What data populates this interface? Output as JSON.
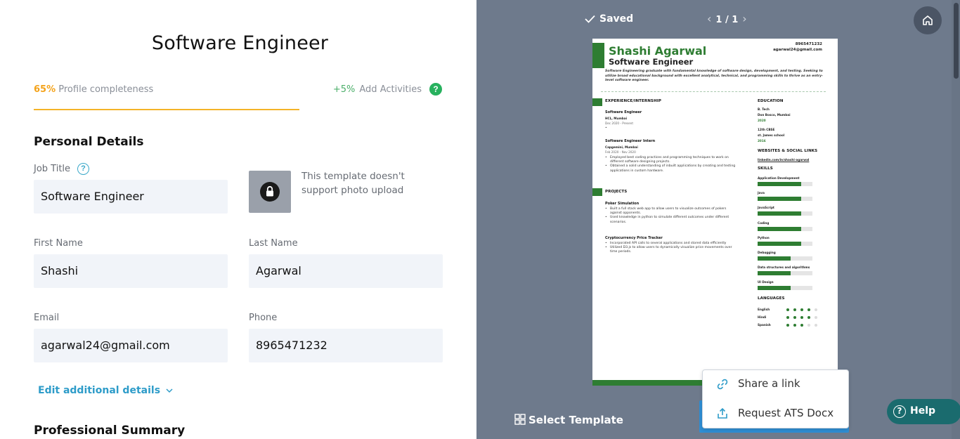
{
  "editor": {
    "title": "Software Engineer",
    "completeness_pct": "65%",
    "completeness_label": "Profile completeness",
    "add_pct": "+5%",
    "add_label": "Add Activities",
    "help_mark": "?"
  },
  "personal": {
    "heading": "Personal Details",
    "job_title_label": "Job Title",
    "job_title_value": "Software Engineer",
    "info_mark": "?",
    "photo_note": "This template doesn't support photo upload",
    "first_name_label": "First Name",
    "first_name_value": "Shashi",
    "last_name_label": "Last Name",
    "last_name_value": "Agarwal",
    "email_label": "Email",
    "email_value": "agarwal24@gmail.com",
    "phone_label": "Phone",
    "phone_value": "8965471232",
    "edit_link": "Edit additional details"
  },
  "summary_section": {
    "heading": "Professional Summary"
  },
  "preview": {
    "saved": "Saved",
    "page_indicator": "1 / 1",
    "prev_chevron": "‹",
    "next_chevron": "›",
    "select_template": "Select Template",
    "share_menu": [
      {
        "label": "Share a link",
        "icon": "link-icon"
      },
      {
        "label": "Request ATS Docx",
        "icon": "upload-icon"
      }
    ],
    "help_label": "Help",
    "help_mark": "?"
  },
  "resume": {
    "name": "Shashi Agarwal",
    "role": "Software Engineer",
    "phone": "8965471232",
    "email": "agarwal24@gmail.com",
    "summary": "Software Engineering graduate with fundamental knowledge of software design, development, and testing. Seeking to utilize broad educational background with excellent analytical, technical, and programming skills to thrive as an entry-level software engineer.",
    "experience_heading": "EXPERIENCE/INTERNSHIP",
    "jobs": [
      {
        "title": "Software Engineer",
        "company": "HCL, Mumbai",
        "dates": "Dec 2020 - Present",
        "bullets": [
          ""
        ]
      },
      {
        "title": "Software Engineer Intern",
        "company": "Capgemini, Mumbai",
        "dates": "Feb 2020 - Nov 2020",
        "bullets": [
          "Employed best coding practices and programming techniques to work on different software designing projects.",
          "Obtained a solid understanding of inbuilt applications by creating and testing applications in custom hardware."
        ]
      }
    ],
    "projects_heading": "PROJECTS",
    "projects": [
      {
        "title": "Poker Simulation",
        "bullets": [
          "Built a full stack web app to allow users to visualize outcomes of pokers against opponents.",
          "Used knowledge in python to simulate different outcomes under different scenarios."
        ]
      },
      {
        "title": "Cryptocurrency Price Tracker",
        "bullets": [
          "Incorporated API calls to several applications and stored data efficiently",
          "Utilized D3.js to allow users to dynamically visualize price movements over time periods."
        ]
      }
    ],
    "education_heading": "EDUCATION",
    "education": [
      {
        "degree": "B. Tech",
        "school": "Don Bosco, Mumbai",
        "year": "2020"
      },
      {
        "degree": "12th CBSE",
        "school": "st. James school",
        "year": "2016"
      }
    ],
    "links_heading": "WEBSITES & SOCIAL LINKS",
    "link": "linkedin.com/in/shashi-agarwal",
    "skills_heading": "SKILLS",
    "skills": [
      {
        "name": "Application Development",
        "level": 0.8
      },
      {
        "name": "Java",
        "level": 0.8
      },
      {
        "name": "JavaScript",
        "level": 0.8
      },
      {
        "name": "Coding",
        "level": 0.8
      },
      {
        "name": "Python",
        "level": 0.8
      },
      {
        "name": "Debugging",
        "level": 0.6
      },
      {
        "name": "Data structures and algorithms",
        "level": 0.6
      },
      {
        "name": "UI Design",
        "level": 0.6
      }
    ],
    "languages_heading": "LANGUAGES",
    "languages": [
      {
        "name": "English",
        "level": 4,
        "max": 5
      },
      {
        "name": "Hindi",
        "level": 4,
        "max": 5
      },
      {
        "name": "Spanish",
        "level": 3,
        "max": 5
      }
    ]
  },
  "colors": {
    "accent_green": "#2e7d32",
    "link_blue": "#2e9cc9",
    "progress_orange": "#f4a31b",
    "panel_grey": "#6e7a8c",
    "help_teal": "#1a6b6e"
  }
}
